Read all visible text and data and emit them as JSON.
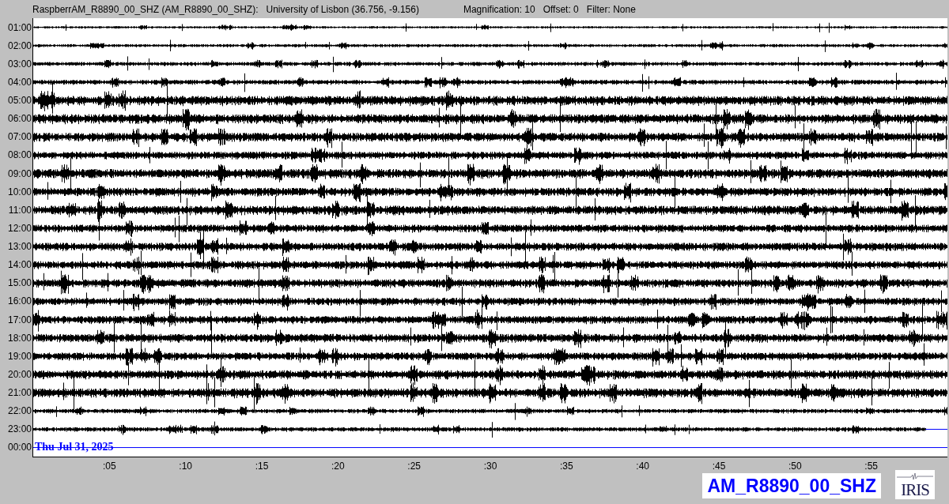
{
  "header": {
    "station": "RaspberrAM_R8890_00_SHZ (AM_R8890_00_SHZ):",
    "location": "University of Lisbon (36.756, -9.156)",
    "magnification": "Magnification: 10",
    "offset": "Offset: 0",
    "filter": "Filter: None"
  },
  "rows": [
    {
      "label": "01:00",
      "kind": "trace"
    },
    {
      "label": "02:00",
      "kind": "trace"
    },
    {
      "label": "03:00",
      "kind": "trace"
    },
    {
      "label": "04:00",
      "kind": "trace"
    },
    {
      "label": "05:00",
      "kind": "trace"
    },
    {
      "label": "06:00",
      "kind": "trace"
    },
    {
      "label": "07:00",
      "kind": "trace"
    },
    {
      "label": "08:00",
      "kind": "trace"
    },
    {
      "label": "09:00",
      "kind": "trace"
    },
    {
      "label": "10:00",
      "kind": "trace"
    },
    {
      "label": "11:00",
      "kind": "trace"
    },
    {
      "label": "12:00",
      "kind": "trace"
    },
    {
      "label": "13:00",
      "kind": "trace"
    },
    {
      "label": "14:00",
      "kind": "trace"
    },
    {
      "label": "15:00",
      "kind": "trace"
    },
    {
      "label": "16:00",
      "kind": "trace"
    },
    {
      "label": "17:00",
      "kind": "trace"
    },
    {
      "label": "18:00",
      "kind": "trace"
    },
    {
      "label": "19:00",
      "kind": "trace"
    },
    {
      "label": "20:00",
      "kind": "trace"
    },
    {
      "label": "21:00",
      "kind": "trace"
    },
    {
      "label": "22:00",
      "kind": "trace"
    },
    {
      "label": "23:00",
      "kind": "partial",
      "level": 0.976
    },
    {
      "label": "00:00",
      "kind": "pending"
    }
  ],
  "date": "Thu Jul 31, 2025",
  "x_ticks": [
    ":05",
    ":10",
    ":15",
    ":20",
    ":25",
    ":30",
    ":35",
    ":40",
    ":45",
    ":50",
    ":55"
  ],
  "station_label": "AM_R8890_00_SHZ",
  "logo_text": "IRIS"
}
